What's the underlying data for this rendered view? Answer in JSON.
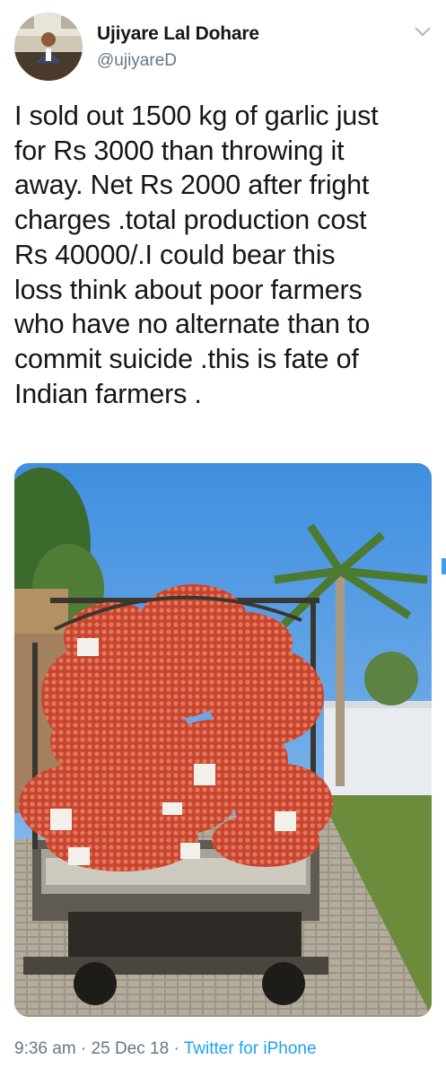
{
  "tweet": {
    "author_name": "Ujiyare Lal Dohare",
    "author_handle": "@ujiyareD",
    "text": "I sold out 1500 kg of garlic just\nfor Rs 3000 than throwing it\naway. Net Rs 2000 after fright\ncharges .total production cost\nRs 40000/.I could bear this\nloss think about poor farmers\nwho have no alternate than to\ncommit suicide .this is fate of\nIndian farmers .",
    "time": "9:36 am",
    "separator1": " · ",
    "date": "25 Dec 18",
    "separator2": " · ",
    "source": "Twitter for iPhone"
  },
  "icons": {
    "menu": "chevron-down-icon"
  },
  "colors": {
    "text": "#14171a",
    "secondary": "#657786",
    "link": "#1da1f2",
    "sky": "#4f9ee6",
    "sacks": "#d2553a"
  }
}
